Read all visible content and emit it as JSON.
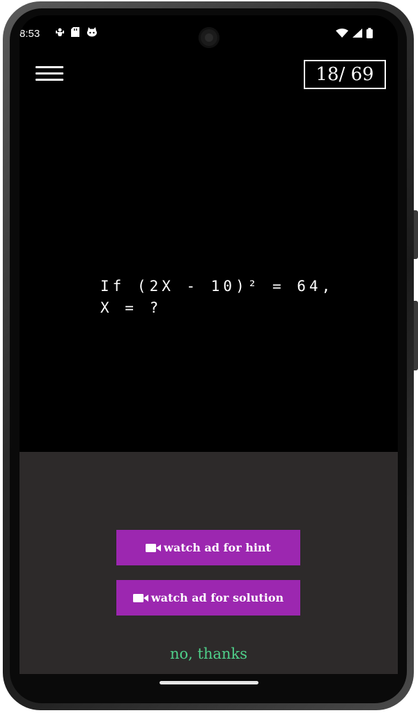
{
  "status_bar": {
    "time": "8:53",
    "left_icons": [
      "usb-debug-icon",
      "sd-card-icon",
      "cat-face-icon"
    ],
    "right_icons": [
      "wifi-icon",
      "signal-icon",
      "battery-icon"
    ]
  },
  "header": {
    "menu_icon": "hamburger-menu-icon",
    "counter": "18/ 69"
  },
  "question": {
    "text": "If (2X - 10)² = 64,\nX = ?"
  },
  "panel": {
    "hint_button": "watch ad for hint",
    "solution_button": "watch ad for solution",
    "dismiss": "no, thanks"
  },
  "colors": {
    "button_bg": "#9c27b0",
    "panel_bg": "#2d2a2a",
    "dismiss_text": "#4fd08a"
  }
}
